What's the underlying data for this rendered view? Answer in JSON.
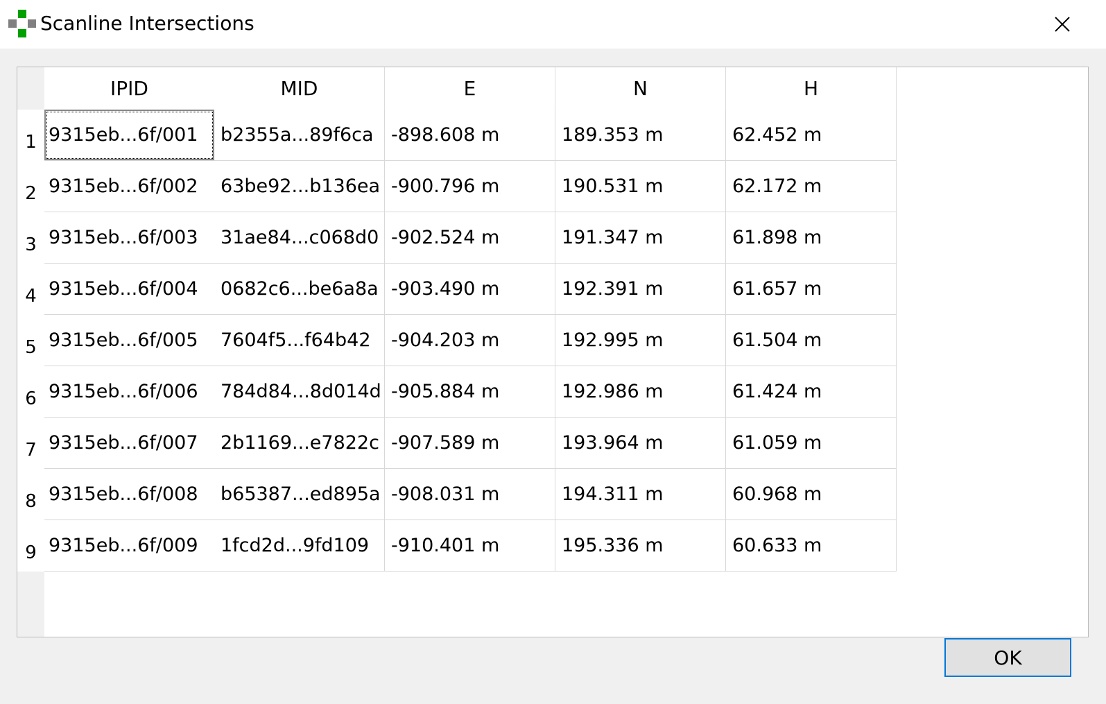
{
  "window": {
    "title": "Scanline Intersections",
    "icon": "app-cross-icon",
    "close_icon": "close-icon",
    "icon_colors": {
      "gray": "#808080",
      "green": "#00a000"
    }
  },
  "table": {
    "columns": [
      "IPID",
      "MID",
      "E",
      "N",
      "H"
    ],
    "rows": [
      {
        "num": "1",
        "cells": [
          "9315eb...6f/001",
          "b2355a...89f6ca",
          "-898.608 m",
          "189.353 m",
          "62.452 m"
        ]
      },
      {
        "num": "2",
        "cells": [
          "9315eb...6f/002",
          "63be92...b136ea",
          "-900.796 m",
          "190.531 m",
          "62.172 m"
        ]
      },
      {
        "num": "3",
        "cells": [
          "9315eb...6f/003",
          "31ae84...c068d0",
          "-902.524 m",
          "191.347 m",
          "61.898 m"
        ]
      },
      {
        "num": "4",
        "cells": [
          "9315eb...6f/004",
          "0682c6...be6a8a",
          "-903.490 m",
          "192.391 m",
          "61.657 m"
        ]
      },
      {
        "num": "5",
        "cells": [
          "9315eb...6f/005",
          "7604f5...f64b42",
          "-904.203 m",
          "192.995 m",
          "61.504 m"
        ]
      },
      {
        "num": "6",
        "cells": [
          "9315eb...6f/006",
          "784d84...8d014d",
          "-905.884 m",
          "192.986 m",
          "61.424 m"
        ]
      },
      {
        "num": "7",
        "cells": [
          "9315eb...6f/007",
          "2b1169...e7822c",
          "-907.589 m",
          "193.964 m",
          "61.059 m"
        ]
      },
      {
        "num": "8",
        "cells": [
          "9315eb...6f/008",
          "b65387...ed895a",
          "-908.031 m",
          "194.311 m",
          "60.968 m"
        ]
      },
      {
        "num": "9",
        "cells": [
          "9315eb...6f/009",
          "1fcd2d...9fd109",
          "-910.401 m",
          "195.336 m",
          "60.633 m"
        ]
      }
    ]
  },
  "footer": {
    "ok_label": "OK",
    "ok_border_color": "#0078d7"
  }
}
